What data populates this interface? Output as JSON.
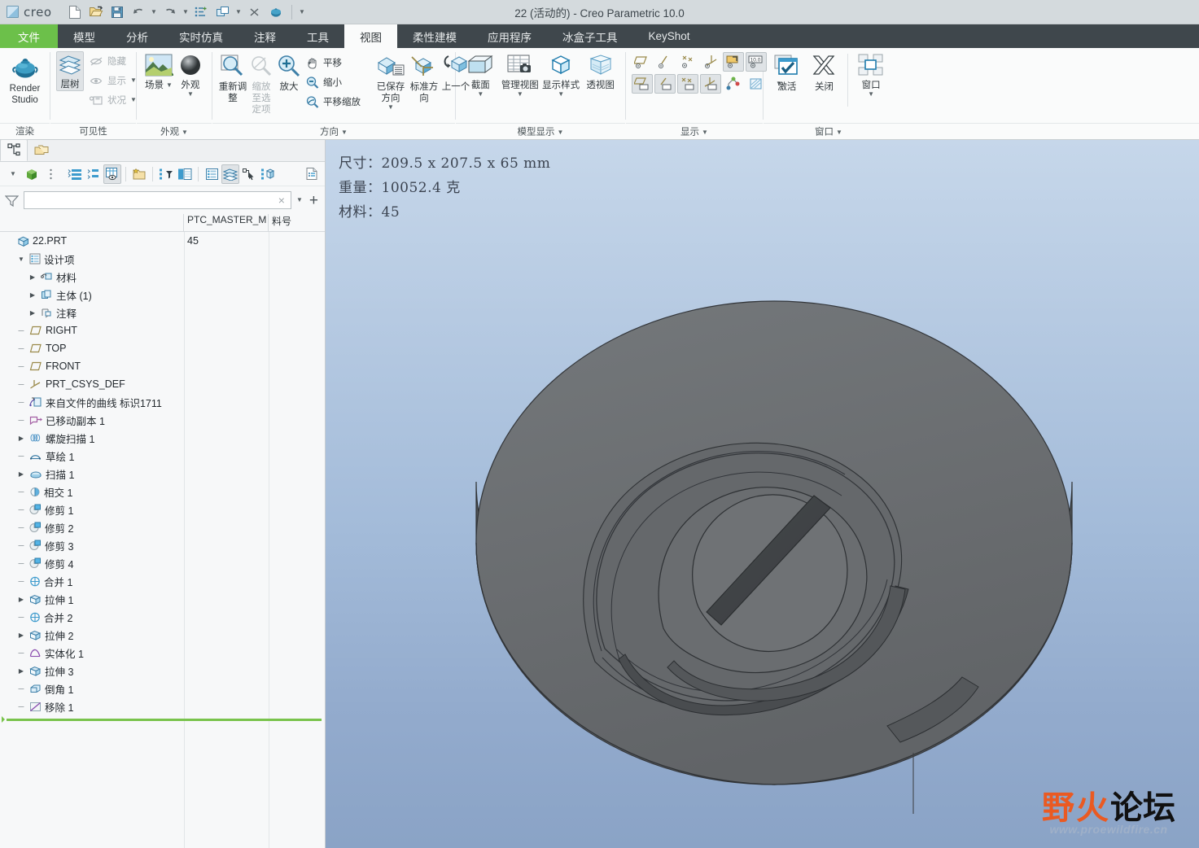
{
  "titlebar": {
    "brand": "creo",
    "brand_sup": "·",
    "window_title": "22 (活动的) - Creo Parametric 10.0",
    "qat_items": [
      {
        "name": "new-file-icon",
        "tip": "新建"
      },
      {
        "name": "open-file-icon",
        "tip": "打开"
      },
      {
        "name": "save-icon",
        "tip": "保存"
      },
      {
        "name": "undo-icon",
        "tip": "撤消"
      },
      {
        "name": "undo-dropdown-icon",
        "tip": "撤消列表"
      },
      {
        "name": "redo-icon",
        "tip": "重做"
      },
      {
        "name": "redo-dropdown-icon",
        "tip": "重做列表"
      },
      {
        "name": "regenerate-icon",
        "tip": "重新生成"
      },
      {
        "name": "window-switch-icon",
        "tip": "切换窗口"
      },
      {
        "name": "window-switch-dropdown-icon",
        "tip": "窗口列表"
      },
      {
        "name": "close-window-icon",
        "tip": "关闭"
      },
      {
        "name": "teapot-render-icon",
        "tip": "渲染"
      },
      {
        "name": "qat-customize-icon",
        "tip": "自定义快速访问工具栏"
      }
    ]
  },
  "ribbon_tabs": [
    {
      "label": "文件",
      "state": "file"
    },
    {
      "label": "模型",
      "state": "normal"
    },
    {
      "label": "分析",
      "state": "normal"
    },
    {
      "label": "实时仿真",
      "state": "normal"
    },
    {
      "label": "注释",
      "state": "normal"
    },
    {
      "label": "工具",
      "state": "normal"
    },
    {
      "label": "视图",
      "state": "active"
    },
    {
      "label": "柔性建模",
      "state": "normal"
    },
    {
      "label": "应用程序",
      "state": "normal"
    },
    {
      "label": "冰盒子工具",
      "state": "normal"
    },
    {
      "label": "KeyShot",
      "state": "normal"
    }
  ],
  "ribbon": {
    "groups": [
      {
        "label": "渲染",
        "has_dialog_caret": false,
        "buttons": [
          {
            "name": "render-studio-button",
            "label": "Render\nStudio",
            "icon": "teapot-icon",
            "enabled": true
          }
        ]
      },
      {
        "label": "可见性",
        "has_dialog_caret": false,
        "buttons": [
          {
            "name": "layer-tree-button",
            "label": "层树",
            "icon": "layers-icon",
            "enabled": true,
            "selected": true
          },
          {
            "name": "hide-button",
            "label": "隐藏",
            "icon": "hide-eye-icon",
            "enabled": false
          },
          {
            "name": "show-button",
            "label": "显示",
            "icon": "show-eye-icon",
            "enabled": false,
            "caret": true
          },
          {
            "name": "status-button",
            "label": "状况",
            "icon": "status-save-icon",
            "enabled": false,
            "caret": true
          }
        ]
      },
      {
        "label": "外观",
        "has_dialog_caret": true,
        "buttons": [
          {
            "name": "scene-button",
            "label": "场景",
            "icon": "scene-landscape-icon",
            "enabled": true,
            "caret": true
          },
          {
            "name": "appearance-button",
            "label": "外观",
            "icon": "appearance-sphere-icon",
            "enabled": true,
            "caret": true
          }
        ]
      },
      {
        "label": "方向",
        "has_dialog_caret": true,
        "buttons": [
          {
            "name": "refit-button",
            "label": "重新调整",
            "icon": "refit-magnifier-icon",
            "enabled": true
          },
          {
            "name": "zoom-to-selection-button",
            "label": "缩放至选定项",
            "icon": "zoom-selection-icon",
            "enabled": false
          },
          {
            "name": "zoom-in-button",
            "label": "放大",
            "icon": "zoom-in-icon",
            "enabled": true
          },
          {
            "name": "pan-button",
            "label": "平移",
            "icon": "hand-pan-icon",
            "enabled": true
          },
          {
            "name": "zoom-out-button",
            "label": "缩小",
            "icon": "zoom-out-icon",
            "enabled": true
          },
          {
            "name": "pan-zoom-button",
            "label": "平移缩放",
            "icon": "pan-zoom-icon",
            "enabled": true
          },
          {
            "name": "saved-orientations-button",
            "label": "已保存方向",
            "icon": "saved-orientation-icon",
            "enabled": true,
            "caret": true
          },
          {
            "name": "standard-orientation-button",
            "label": "标准方向",
            "icon": "standard-orientation-icon",
            "enabled": true
          },
          {
            "name": "previous-orientation-button",
            "label": "上一个",
            "icon": "previous-orientation-icon",
            "enabled": true
          }
        ]
      },
      {
        "label": "模型显示",
        "has_dialog_caret": true,
        "buttons": [
          {
            "name": "cross-section-button",
            "label": "截面",
            "icon": "cross-section-icon",
            "enabled": true,
            "caret": true
          },
          {
            "name": "manage-views-button",
            "label": "管理视图",
            "icon": "manage-views-icon",
            "enabled": true,
            "caret": true
          },
          {
            "name": "display-style-button",
            "label": "显示样式",
            "icon": "display-style-cube-icon",
            "enabled": true,
            "caret": true
          },
          {
            "name": "perspective-view-button",
            "label": "透视图",
            "icon": "perspective-cube-icon",
            "enabled": true
          }
        ]
      },
      {
        "label": "显示",
        "has_dialog_caret": true,
        "buttons": [
          {
            "name": "plane-display-button",
            "icon": "datum-plane-icon",
            "enabled": true
          },
          {
            "name": "axis-display-button",
            "icon": "datum-axis-icon",
            "enabled": true
          },
          {
            "name": "point-display-button",
            "icon": "datum-point-icon",
            "enabled": true
          },
          {
            "name": "csys-display-button",
            "icon": "datum-csys-icon",
            "enabled": true
          },
          {
            "name": "annotation-display-button",
            "icon": "annotation-tag-icon",
            "enabled": true,
            "selected": true
          },
          {
            "name": "dimension-display-button",
            "icon": "dimension-10-icon",
            "enabled": true,
            "selected": true
          },
          {
            "name": "plane-tag-display-button",
            "icon": "plane-tag-icon",
            "enabled": true,
            "selected": true
          },
          {
            "name": "axis-tag-display-button",
            "icon": "axis-tag-icon",
            "enabled": true,
            "selected": true
          },
          {
            "name": "point-tag-display-button",
            "icon": "point-tag-icon",
            "enabled": true,
            "selected": true
          },
          {
            "name": "csys-tag-display-button",
            "icon": "csys-tag-icon",
            "enabled": true,
            "selected": true
          },
          {
            "name": "spin-center-button",
            "icon": "spin-center-icon",
            "enabled": true
          },
          {
            "name": "hidden-line-button",
            "icon": "hidden-line-icon",
            "enabled": true
          },
          {
            "name": "display-more-caret",
            "icon": "chevron-down-icon",
            "enabled": true
          }
        ]
      },
      {
        "label": "窗口",
        "has_dialog_caret": true,
        "buttons": [
          {
            "name": "activate-button",
            "label": "激活",
            "icon": "activate-check-icon",
            "enabled": true
          },
          {
            "name": "close-button",
            "label": "关闭",
            "icon": "close-x-icon",
            "enabled": true
          },
          {
            "name": "window-button",
            "label": "窗口",
            "icon": "window-cascade-icon",
            "enabled": true,
            "caret": true
          }
        ]
      }
    ]
  },
  "left_panel": {
    "nav_tabs": [
      {
        "name": "model-tree-tab",
        "icon": "model-tree-icon",
        "active": true
      },
      {
        "name": "layer-tree-tab",
        "icon": "folders-icon",
        "active": false
      }
    ],
    "tree_toolbar": [
      {
        "name": "tree-settings-caret",
        "icon": "chevron-down-icon"
      },
      {
        "name": "tree-model-icon",
        "icon": "green-cube-icon"
      },
      {
        "name": "tree-drag-handle",
        "icon": "vertical-dots-icon"
      },
      {
        "name": "expand-all-button",
        "icon": "expand-list-icon"
      },
      {
        "name": "collapse-all-button",
        "icon": "collapse-list-icon"
      },
      {
        "name": "show-columns-button",
        "icon": "table-eye-icon",
        "selected": true
      },
      {
        "name": "tree-filters-button",
        "icon": "folder-star-icon"
      },
      {
        "name": "tree-filter-button",
        "icon": "filter-tree-icon"
      },
      {
        "name": "tree-columns-button",
        "icon": "columns-icon"
      },
      {
        "name": "item-details-button",
        "icon": "details-list-icon"
      },
      {
        "name": "layers-view-button",
        "icon": "layers-stack-icon",
        "selected": true
      },
      {
        "name": "select-in-tree-button",
        "icon": "tree-select-icon"
      },
      {
        "name": "tree-structure-button",
        "icon": "tree-structure-icon"
      },
      {
        "name": "tree-report-button",
        "icon": "report-icon"
      }
    ],
    "filter": {
      "icon": "filter-funnel-icon",
      "value": "",
      "placeholder": "",
      "clear_label": "×",
      "dropdown_icon": "chevron-down-icon",
      "add_icon": "plus-icon"
    },
    "columns": [
      "",
      "PTC_MASTER_M",
      "料号"
    ],
    "tree": [
      {
        "label": "22.PRT",
        "indent": 0,
        "toggle": "none",
        "icon": "part-icon",
        "attr": "45"
      },
      {
        "label": "设计项",
        "indent": 1,
        "toggle": "expanded",
        "icon": "design-items-icon",
        "attr": ""
      },
      {
        "label": "材料",
        "indent": 2,
        "toggle": "collapsed",
        "icon": "material-icon",
        "attr": ""
      },
      {
        "label": "主体 (1)",
        "indent": 2,
        "toggle": "collapsed",
        "icon": "bodies-icon",
        "attr": ""
      },
      {
        "label": "注释",
        "indent": 2,
        "toggle": "collapsed",
        "icon": "annotations-icon",
        "attr": ""
      },
      {
        "label": "RIGHT",
        "indent": 1,
        "toggle": "leaf",
        "icon": "datum-plane-icon",
        "attr": ""
      },
      {
        "label": "TOP",
        "indent": 1,
        "toggle": "leaf",
        "icon": "datum-plane-icon",
        "attr": ""
      },
      {
        "label": "FRONT",
        "indent": 1,
        "toggle": "leaf",
        "icon": "datum-plane-icon",
        "attr": ""
      },
      {
        "label": "PRT_CSYS_DEF",
        "indent": 1,
        "toggle": "leaf",
        "icon": "datum-csys-icon",
        "attr": ""
      },
      {
        "label": "来自文件的曲线 标识1711",
        "indent": 1,
        "toggle": "leaf",
        "icon": "curve-from-file-icon",
        "attr": ""
      },
      {
        "label": "已移动副本 1",
        "indent": 1,
        "toggle": "leaf",
        "icon": "moved-copy-icon",
        "attr": ""
      },
      {
        "label": "螺旋扫描 1",
        "indent": 1,
        "toggle": "collapsed",
        "icon": "helical-sweep-icon",
        "attr": ""
      },
      {
        "label": "草绘 1",
        "indent": 1,
        "toggle": "leaf",
        "icon": "sketch-icon",
        "attr": ""
      },
      {
        "label": "扫描 1",
        "indent": 1,
        "toggle": "collapsed",
        "icon": "sweep-icon",
        "attr": ""
      },
      {
        "label": "相交 1",
        "indent": 1,
        "toggle": "leaf",
        "icon": "intersect-icon",
        "attr": ""
      },
      {
        "label": "修剪 1",
        "indent": 1,
        "toggle": "leaf",
        "icon": "trim-icon",
        "attr": ""
      },
      {
        "label": "修剪 2",
        "indent": 1,
        "toggle": "leaf",
        "icon": "trim-icon",
        "attr": ""
      },
      {
        "label": "修剪 3",
        "indent": 1,
        "toggle": "leaf",
        "icon": "trim-icon",
        "attr": ""
      },
      {
        "label": "修剪 4",
        "indent": 1,
        "toggle": "leaf",
        "icon": "trim-icon",
        "attr": ""
      },
      {
        "label": "合并 1",
        "indent": 1,
        "toggle": "leaf",
        "icon": "merge-icon",
        "attr": ""
      },
      {
        "label": "拉伸 1",
        "indent": 1,
        "toggle": "collapsed",
        "icon": "extrude-icon",
        "attr": ""
      },
      {
        "label": "合并 2",
        "indent": 1,
        "toggle": "leaf",
        "icon": "merge-icon",
        "attr": ""
      },
      {
        "label": "拉伸 2",
        "indent": 1,
        "toggle": "collapsed",
        "icon": "extrude-icon",
        "attr": ""
      },
      {
        "label": "实体化 1",
        "indent": 1,
        "toggle": "leaf",
        "icon": "solidify-icon",
        "attr": ""
      },
      {
        "label": "拉伸 3",
        "indent": 1,
        "toggle": "collapsed",
        "icon": "extrude-icon",
        "attr": ""
      },
      {
        "label": "倒角 1",
        "indent": 1,
        "toggle": "leaf",
        "icon": "chamfer-icon",
        "attr": ""
      },
      {
        "label": "移除 1",
        "indent": 1,
        "toggle": "leaf",
        "icon": "remove-surface-icon",
        "attr": ""
      }
    ]
  },
  "viewport": {
    "info_lines": [
      "尺寸：209.5 x 207.5 x 65 mm",
      "重量：10052.4 克",
      "材料：45"
    ],
    "model": {
      "name": "scroll-plate-3d-model",
      "face_color": "#6a6d70",
      "side_color": "#4e5154",
      "edge_color": "#2a2c2e"
    },
    "watermark": {
      "char1": "野",
      "char2": "火",
      "char3": "论坛",
      "url": "www.proewildfire.cn"
    }
  },
  "colors": {
    "file_tab_green": "#6cc04a",
    "ribbon_tab_bg": "#3f474c",
    "titlebar_bg": "#d4dadd",
    "insert_indicator_green": "#79c34c",
    "viewport_top": "#c6d7ea",
    "viewport_bottom": "#8aa3c6"
  }
}
